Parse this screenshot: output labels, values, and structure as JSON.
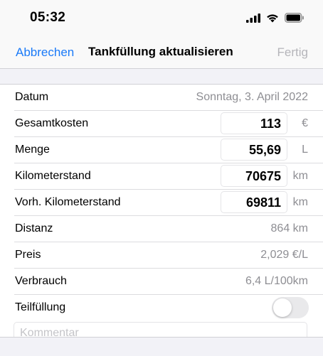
{
  "status_bar": {
    "time": "05:32",
    "icons": [
      "signal-icon",
      "wifi-icon",
      "battery-icon"
    ]
  },
  "nav": {
    "cancel_label": "Abbrechen",
    "title": "Tankfüllung aktualisieren",
    "done_label": "Fertig"
  },
  "form": {
    "datum": {
      "label": "Datum",
      "value": "Sonntag, 3. April 2022"
    },
    "gesamtkosten": {
      "label": "Gesamtkosten",
      "value": "113",
      "unit": "€"
    },
    "menge": {
      "label": "Menge",
      "value": "55,69",
      "unit": "L"
    },
    "kilometerstand": {
      "label": "Kilometerstand",
      "value": "70675",
      "unit": "km"
    },
    "vorh_kilometerstand": {
      "label": "Vorh. Kilometerstand",
      "value": "69811",
      "unit": "km"
    },
    "distanz": {
      "label": "Distanz",
      "value": "864 km"
    },
    "preis": {
      "label": "Preis",
      "value": "2,029 €/L"
    },
    "verbrauch": {
      "label": "Verbrauch",
      "value": "6,4 L/100km"
    },
    "teilfuellung": {
      "label": "Teilfüllung",
      "on": false
    },
    "kommentar": {
      "placeholder": "Kommentar",
      "value": ""
    }
  },
  "colors": {
    "accent": "#1a7af8",
    "disabled": "#b5b5ba",
    "secondary_text": "#8e8e93",
    "background": "#f2f2f7"
  }
}
